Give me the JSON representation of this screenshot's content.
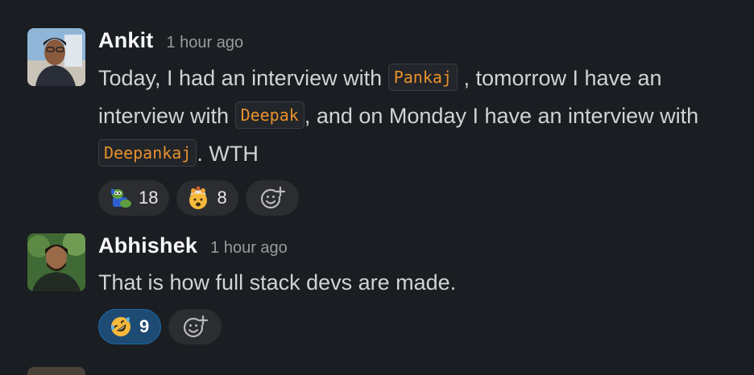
{
  "messages": [
    {
      "author": "Ankit",
      "time": "1 hour ago",
      "text_parts": {
        "t1": "Today, I had an interview with ",
        "c1": "Pankaj",
        "t2": " , tomorrow I have an interview with ",
        "c2": "Deepak",
        "t3": ", and on Monday I have an interview with ",
        "c3": "Deepankaj",
        "t4": ". WTH"
      },
      "reactions": [
        {
          "emoji": "pepe-frog-emoji",
          "count": "18"
        },
        {
          "emoji": "exploding-head-emoji",
          "count": "8"
        }
      ]
    },
    {
      "author": "Abhishek",
      "time": "1 hour ago",
      "text": "That is how full stack devs are made.",
      "reactions": [
        {
          "emoji": "rofl-emoji",
          "count": "9",
          "active": true
        }
      ]
    }
  ],
  "colors": {
    "background": "#1a1d21",
    "code_text": "#e8912d",
    "active_reaction": "#1d4b73"
  }
}
